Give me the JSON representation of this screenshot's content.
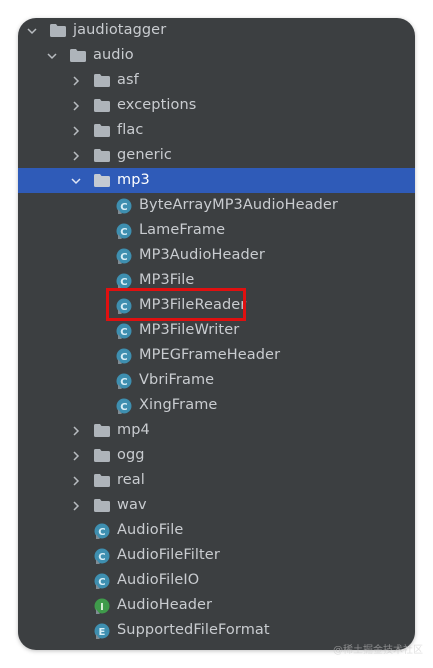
{
  "project_tree": {
    "root": {
      "label": "jaudiotagger",
      "expanded": true
    },
    "audio": {
      "label": "audio",
      "expanded": true
    },
    "packages": [
      {
        "label": "asf",
        "expanded": false
      },
      {
        "label": "exceptions",
        "expanded": false
      },
      {
        "label": "flac",
        "expanded": false
      },
      {
        "label": "generic",
        "expanded": false
      }
    ],
    "mp3": {
      "label": "mp3",
      "expanded": true,
      "selected": true,
      "classes": [
        {
          "label": "ByteArrayMP3AudioHeader",
          "icon": "class-icon"
        },
        {
          "label": "LameFrame",
          "icon": "class-icon"
        },
        {
          "label": "MP3AudioHeader",
          "icon": "class-icon"
        },
        {
          "label": "MP3File",
          "icon": "class-icon"
        },
        {
          "label": "MP3FileReader",
          "icon": "class-icon",
          "highlighted": true
        },
        {
          "label": "MP3FileWriter",
          "icon": "class-icon"
        },
        {
          "label": "MPEGFrameHeader",
          "icon": "class-icon"
        },
        {
          "label": "VbriFrame",
          "icon": "class-icon"
        },
        {
          "label": "XingFrame",
          "icon": "class-icon"
        }
      ]
    },
    "packages_after": [
      {
        "label": "mp4",
        "expanded": false
      },
      {
        "label": "ogg",
        "expanded": false
      },
      {
        "label": "real",
        "expanded": false
      },
      {
        "label": "wav",
        "expanded": false
      }
    ],
    "audio_classes": [
      {
        "label": "AudioFile",
        "icon": "class-icon"
      },
      {
        "label": "AudioFileFilter",
        "icon": "class-icon"
      },
      {
        "label": "AudioFileIO",
        "icon": "class-icon"
      },
      {
        "label": "AudioHeader",
        "icon": "interface-icon"
      },
      {
        "label": "SupportedFileFormat",
        "icon": "enum-icon"
      }
    ]
  },
  "colors": {
    "panel_bg": "#3c3f41",
    "selection": "#2f5bb8",
    "text": "#c9ccd0",
    "highlight_border": "#e01010",
    "class_icon": "#3e8fb0",
    "interface_icon": "#3f9b4b",
    "enum_icon": "#3e8fb0"
  },
  "watermark": "@稀土掘金技术社区"
}
